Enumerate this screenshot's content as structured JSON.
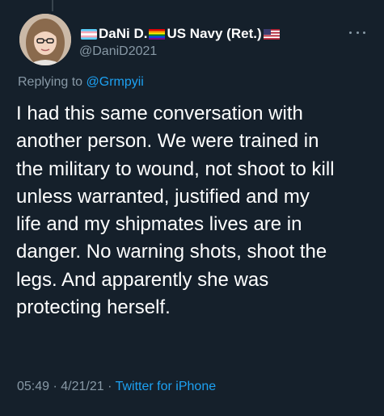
{
  "tweet": {
    "display_name_left_flag": "transgender-flag",
    "display_name": "DaNi D.",
    "display_name_mid_flag": "rainbow-pride-flag",
    "display_name_suffix": "US Navy (Ret.)",
    "display_name_right_flag": "us-flag",
    "handle": "@DaniD2021",
    "more_icon": "more-horizontal-icon",
    "replying_prefix": "Replying to",
    "replying_to": "@Grmpyii",
    "text_lines": [
      "I had this same conversation with",
      "another person. We were trained in",
      "the military to wound, not shoot to kill",
      "unless warranted, justified and my",
      "life and my shipmates lives are in",
      "danger. No warning shots, shoot the",
      "legs. And apparently she was",
      "protecting herself."
    ],
    "time": "05:49",
    "date": "4/21/21",
    "source": "Twitter for iPhone",
    "separator": "·"
  },
  "colors": {
    "background": "#15202b",
    "text": "#ffffff",
    "secondary": "#8899a6",
    "link": "#1da1f2"
  }
}
